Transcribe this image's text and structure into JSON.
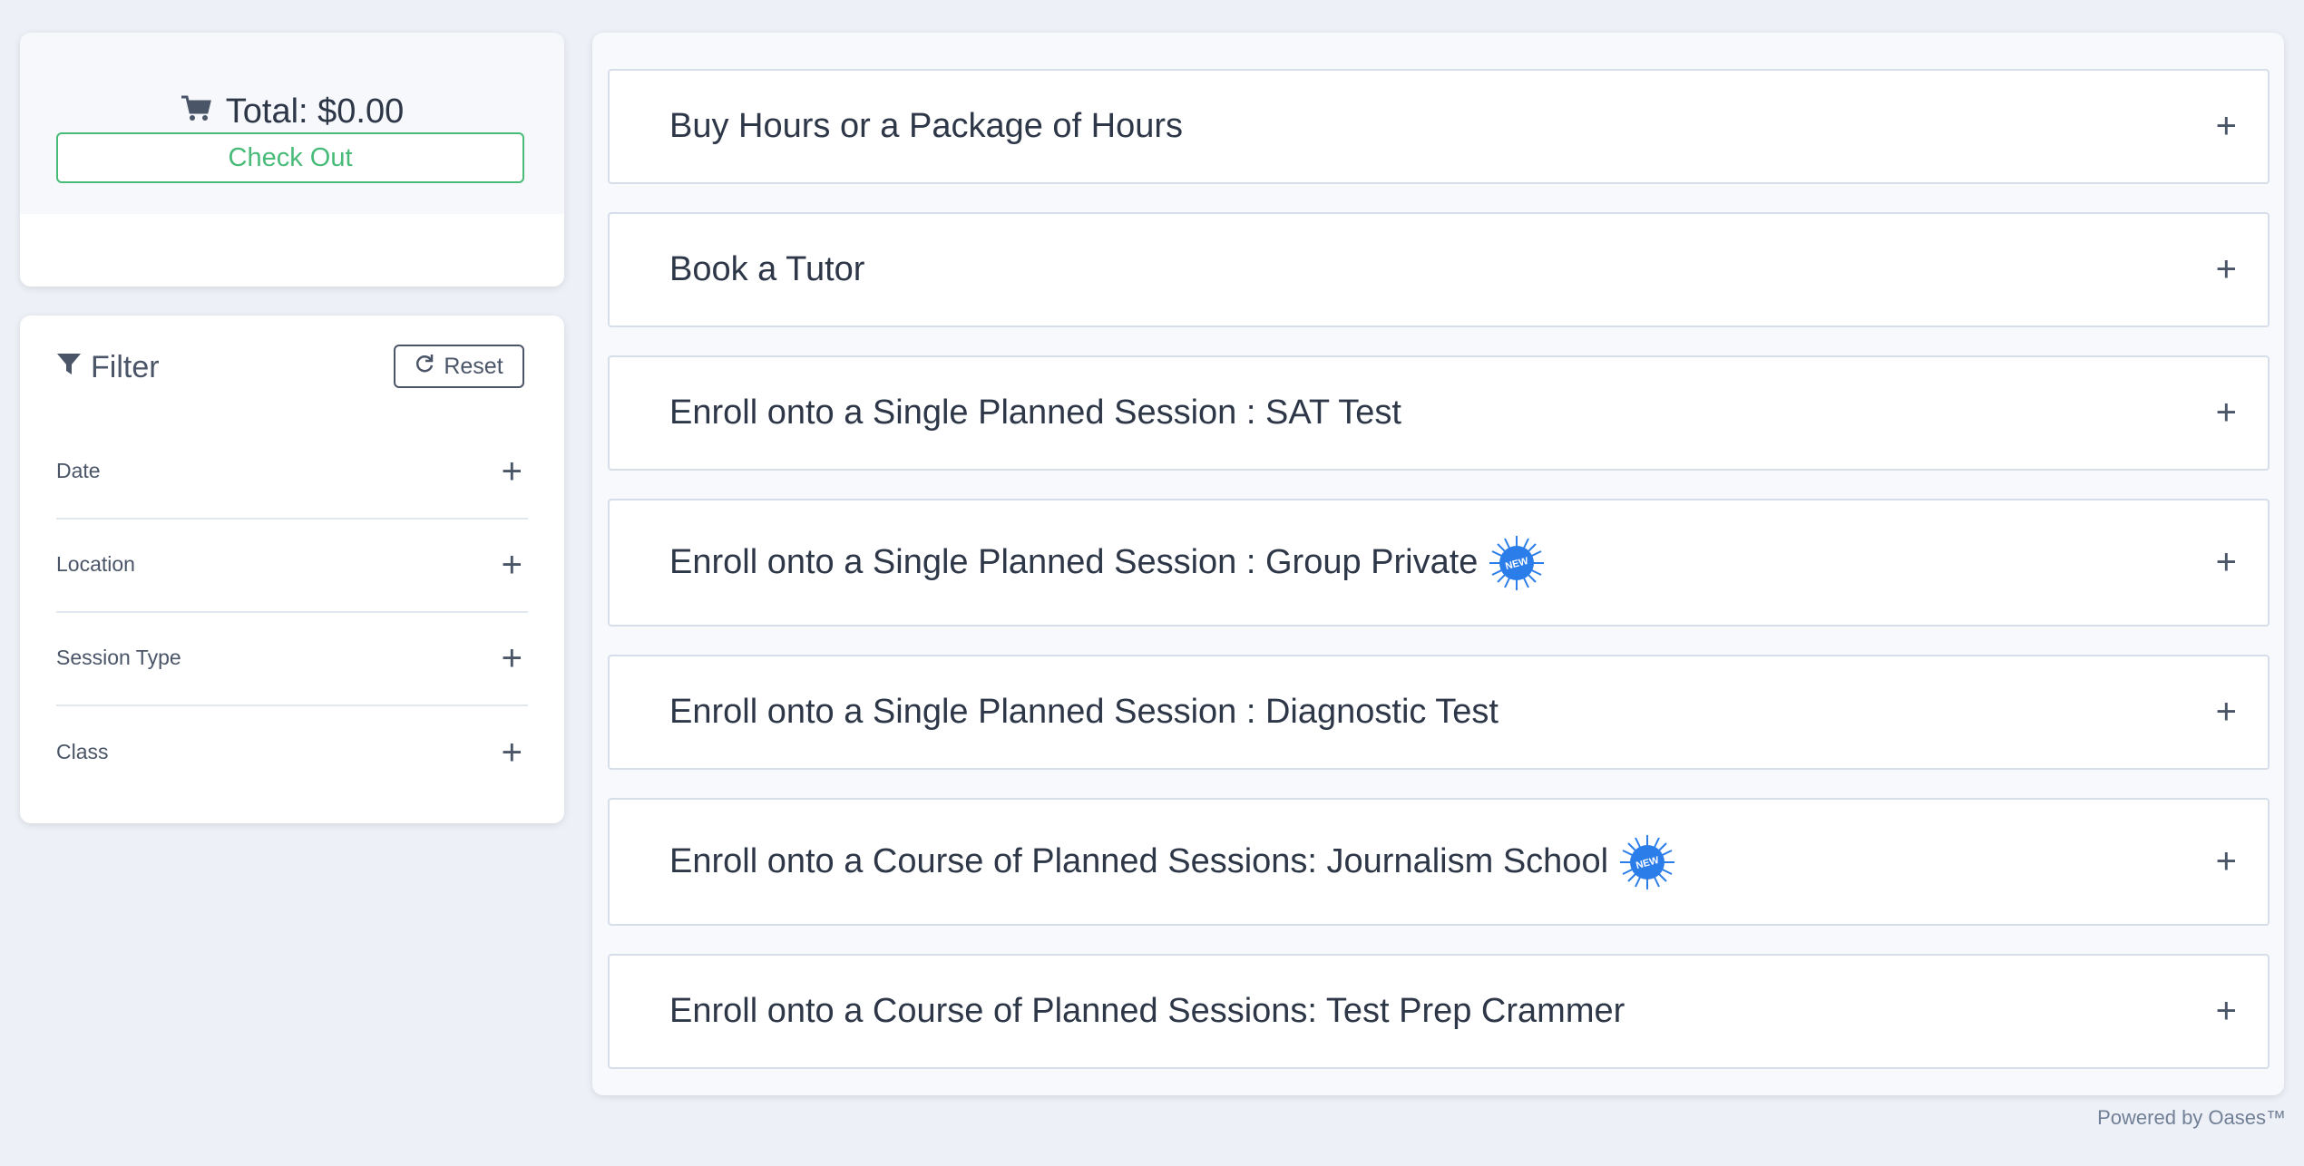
{
  "cart": {
    "total_label": "Total: $0.00",
    "checkout_label": "Check Out"
  },
  "filter": {
    "title": "Filter",
    "reset_label": "Reset",
    "sections": [
      {
        "label": "Date"
      },
      {
        "label": "Location"
      },
      {
        "label": "Session Type"
      },
      {
        "label": "Class"
      }
    ]
  },
  "offerings": [
    {
      "title": "Buy Hours or a Package of Hours",
      "new": false
    },
    {
      "title": "Book a Tutor",
      "new": false
    },
    {
      "title": "Enroll onto a Single Planned Session : SAT Test",
      "new": false
    },
    {
      "title": "Enroll onto a Single Planned Session : Group Private",
      "new": true
    },
    {
      "title": "Enroll onto a Single Planned Session : Diagnostic Test",
      "new": false
    },
    {
      "title": "Enroll onto a Course of Planned Sessions: Journalism School",
      "new": true
    },
    {
      "title": "Enroll onto a Course of Planned Sessions: Test Prep Crammer",
      "new": false
    }
  ],
  "badge_text": "NEW",
  "expand_symbol": "+",
  "footer": {
    "powered_by": "Powered by Oases™"
  },
  "colors": {
    "accent_green": "#48bb78",
    "badge_blue": "#2b7de9",
    "background": "#edf0f7"
  }
}
